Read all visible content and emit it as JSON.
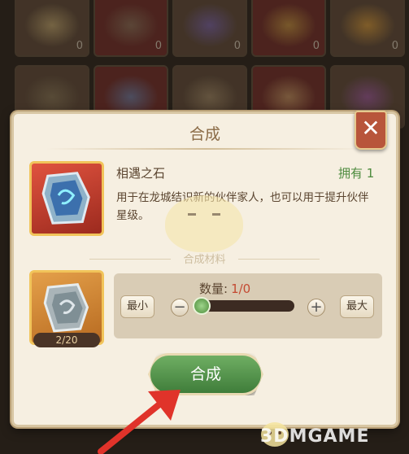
{
  "inventory": {
    "slots_row1": [
      {
        "count": "0",
        "glow": "#c9b075"
      },
      {
        "count": "0",
        "glow": "#8b7a60"
      },
      {
        "count": "0",
        "glow": "#7b66b6"
      },
      {
        "count": "0",
        "glow": "#caa245"
      },
      {
        "count": "0",
        "glow": "#e0a13c"
      }
    ],
    "slots_row2": [
      {
        "glow": "#8a7a5a"
      },
      {
        "glow": "#6a89b5"
      },
      {
        "glow": "#a38d6a"
      },
      {
        "glow": "#c9a26a"
      },
      {
        "glow": "#a25aa8"
      }
    ]
  },
  "dialog": {
    "title": "合成",
    "close_icon": "close-x"
  },
  "item": {
    "name": "相遇之石",
    "owned": "拥有 1",
    "description": "用于在龙城结识新的伙伴家人，也可以用于提升伙伴星级。"
  },
  "materials": {
    "section_label": "合成材料",
    "material_qty": "2/20"
  },
  "quantity": {
    "label": "数量:",
    "value": "1/0",
    "min_label": "最小",
    "max_label": "最大",
    "minus_icon": "minus",
    "plus_icon": "plus",
    "slider_fraction": 0
  },
  "synth_button": {
    "label": "合成"
  },
  "watermark": "3DMGAME",
  "colors": {
    "panel_bg": "#f6efe1",
    "close_red": "#b8553b",
    "owned_green": "#4d8b3e",
    "value_red": "#c44a32",
    "button_green": "#4f8e46",
    "arrow_red": "#e0332a"
  }
}
